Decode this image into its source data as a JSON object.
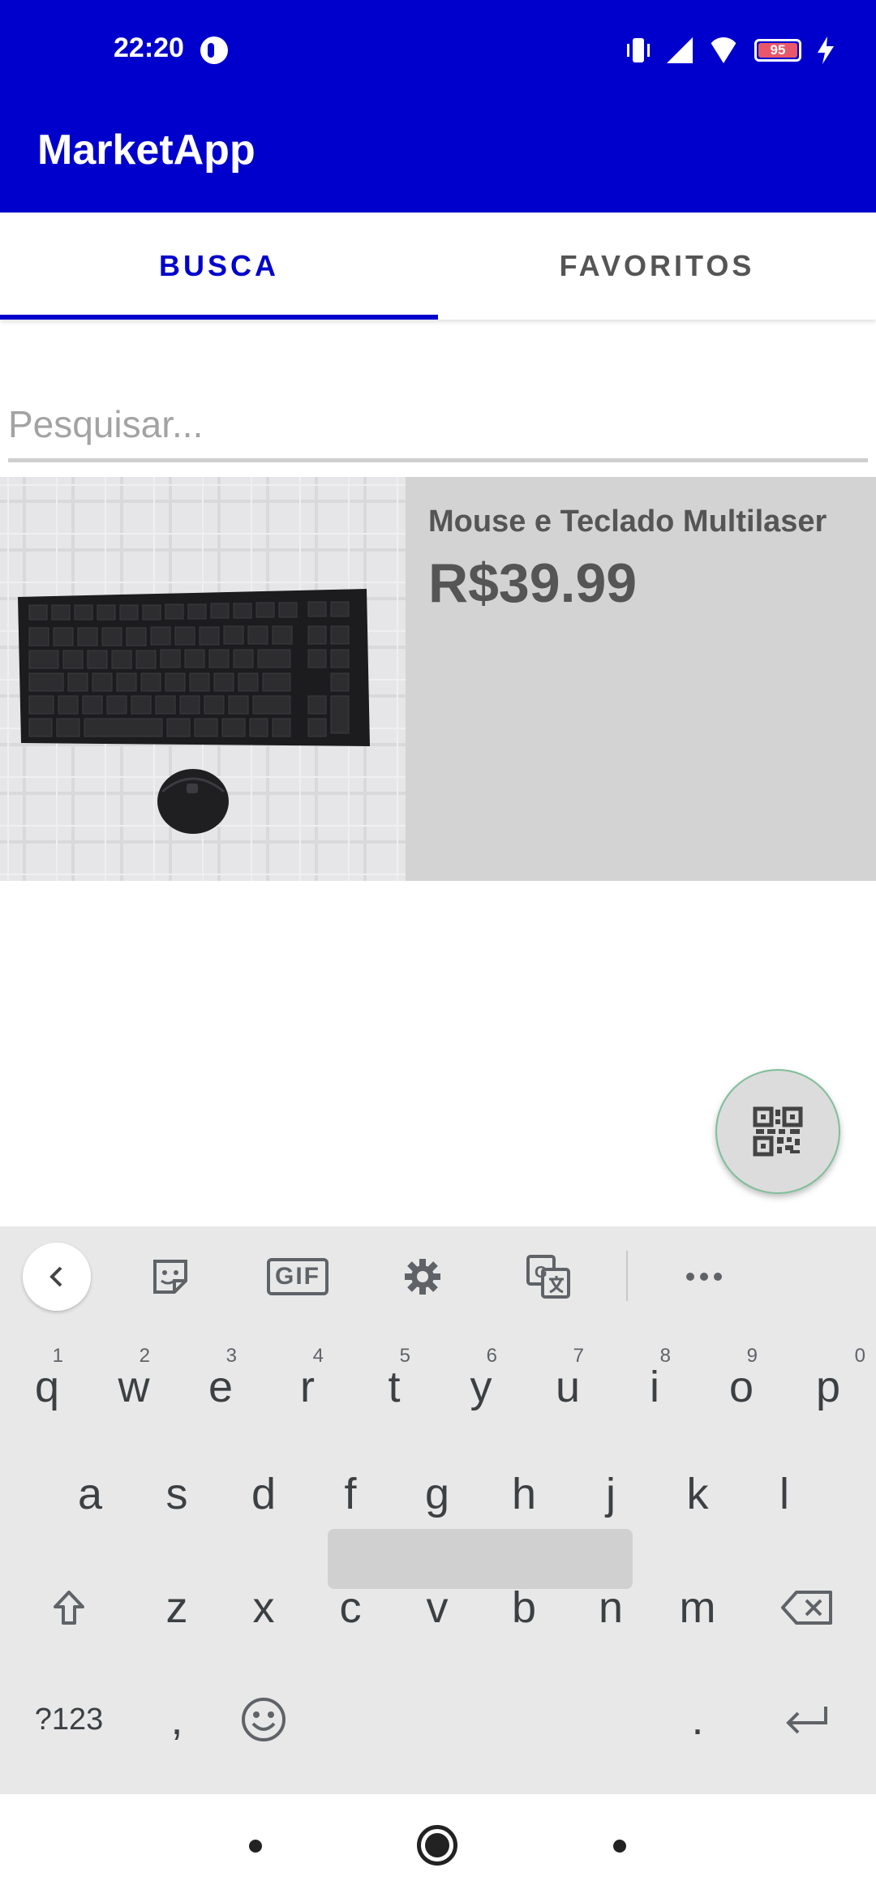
{
  "status_bar": {
    "time": "22:20",
    "battery_level": "95",
    "icons": [
      "app-notification-icon",
      "vibrate-icon",
      "signal-icon",
      "wifi-icon",
      "battery-icon",
      "charging-bolt-icon"
    ]
  },
  "app_bar": {
    "title": "MarketApp",
    "color": "#0000CC"
  },
  "tabs": [
    {
      "label": "BUSCA",
      "selected": true
    },
    {
      "label": "FAVORITOS",
      "selected": false
    }
  ],
  "search": {
    "placeholder": "Pesquisar...",
    "value": ""
  },
  "products": [
    {
      "name": "Mouse e Teclado Multilaser",
      "price": "R$39.99",
      "image": "keyboard-and-mouse-photo"
    }
  ],
  "fab": {
    "icon": "qr-code-icon"
  },
  "keyboard": {
    "toolbar": [
      "back-arrow-icon",
      "sticker-icon",
      "GIF",
      "settings-gear-icon",
      "translate-icon",
      "more-dots-icon"
    ],
    "gif_label": "GIF",
    "rows": [
      [
        "q",
        "w",
        "e",
        "r",
        "t",
        "y",
        "u",
        "i",
        "o",
        "p"
      ],
      [
        "a",
        "s",
        "d",
        "f",
        "g",
        "h",
        "j",
        "k",
        "l"
      ],
      [
        "z",
        "x",
        "c",
        "v",
        "b",
        "n",
        "m"
      ]
    ],
    "number_hints": [
      "1",
      "2",
      "3",
      "4",
      "5",
      "6",
      "7",
      "8",
      "9",
      "0"
    ],
    "symbols_label": "?123",
    "comma": ",",
    "period": "."
  },
  "nav_bar": {
    "icons": [
      "recents-dot-icon",
      "home-circle-icon",
      "back-dot-icon"
    ]
  }
}
